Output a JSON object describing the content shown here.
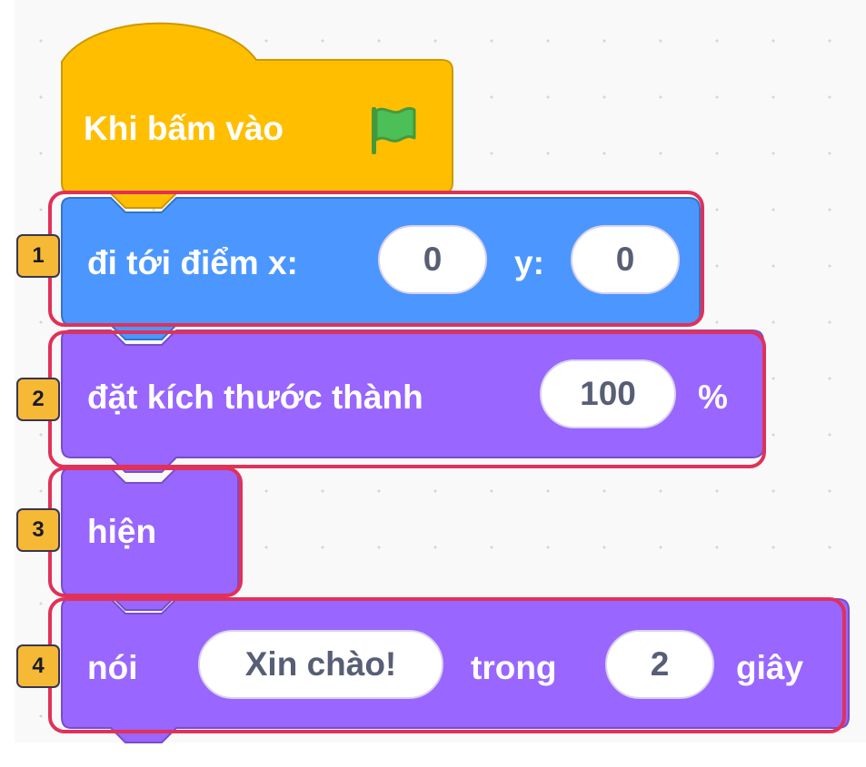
{
  "hat_block": {
    "label": "Khi bấm vào",
    "icon": "green-flag-icon",
    "color": "#ffbf00",
    "dark": "#cc9900"
  },
  "motion_block": {
    "label": "đi tới điểm x:",
    "x_value": "0",
    "y_label": "y:",
    "y_value": "0",
    "color": "#4c97ff"
  },
  "size_block": {
    "label": "đặt kích thước thành",
    "value": "100",
    "unit": "%",
    "color": "#9966ff"
  },
  "show_block": {
    "label": "hiện",
    "color": "#9966ff"
  },
  "say_block": {
    "label": "nói",
    "message": "Xin chào!",
    "middle": "trong",
    "seconds": "2",
    "unit": "giây",
    "color": "#9966ff"
  },
  "badges": [
    "1",
    "2",
    "3",
    "4"
  ],
  "highlight_color": "#e0315a",
  "badge_color": "#f6b935"
}
